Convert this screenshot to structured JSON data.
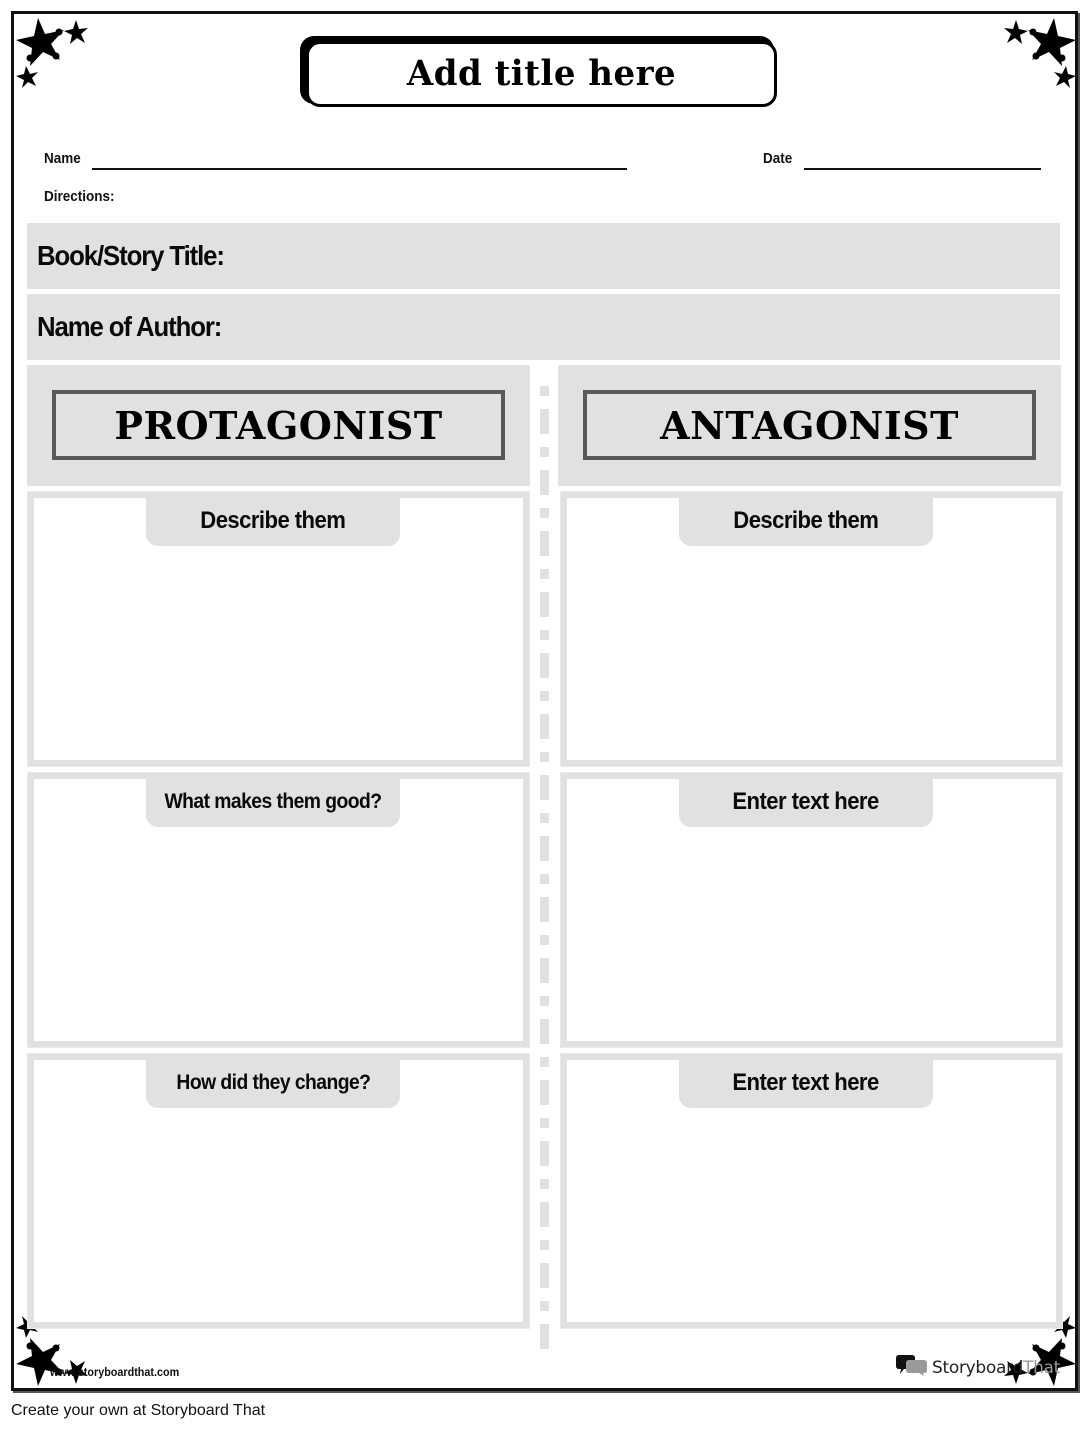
{
  "worksheet": {
    "title": "Add title here",
    "fields": {
      "name_label": "Name",
      "date_label": "Date",
      "directions_label": "Directions:"
    },
    "info_bars": [
      {
        "label": "Book/Story Title:"
      },
      {
        "label": "Name of Author:"
      }
    ],
    "columns": [
      {
        "heading": "PROTAGONIST",
        "boxes": [
          {
            "prompt": "Describe them"
          },
          {
            "prompt": "What makes them good?"
          },
          {
            "prompt": "How did they change?"
          }
        ]
      },
      {
        "heading": "ANTAGONIST",
        "boxes": [
          {
            "prompt": "Describe them"
          },
          {
            "prompt": "Enter text here"
          },
          {
            "prompt": "Enter text here"
          }
        ]
      }
    ],
    "decorations": {
      "corner_icon": "star-cluster-icon",
      "panel_color": "#e1e1e1",
      "role_border_color": "#595959"
    }
  },
  "footer": {
    "site_url": "www.storyboardthat.com",
    "brand_name_dark": "Storyboard",
    "brand_name_light": "That",
    "brand_icon": "speech-bubbles-icon"
  },
  "caption": "Create your own at Storyboard That"
}
